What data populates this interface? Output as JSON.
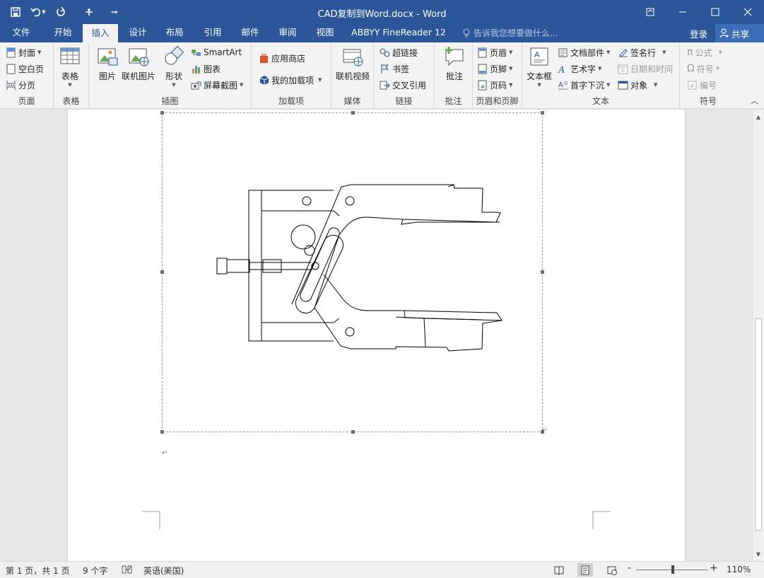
{
  "window": {
    "title": "CAD复制到Word.docx - Word"
  },
  "tabs": [
    {
      "label": "文件"
    },
    {
      "label": "开始"
    },
    {
      "label": "插入"
    },
    {
      "label": "设计"
    },
    {
      "label": "布局"
    },
    {
      "label": "引用"
    },
    {
      "label": "邮件"
    },
    {
      "label": "审阅"
    },
    {
      "label": "视图"
    },
    {
      "label": "ABBYY FineReader 12"
    }
  ],
  "active_tab": "插入",
  "tell_me": "告诉我您想要做什么...",
  "account": {
    "login": "登录",
    "share": "共享"
  },
  "ribbon": {
    "pages": {
      "label": "页面",
      "cover": "封面",
      "blank": "空白页",
      "break": "分页"
    },
    "tables": {
      "label": "表格",
      "table": "表格"
    },
    "illustrations": {
      "label": "插图",
      "picture": "图片",
      "online_picture": "联机图片",
      "shapes": "形状",
      "smartart": "SmartArt",
      "chart": "图表",
      "screenshot": "屏幕截图"
    },
    "addins": {
      "label": "加载项",
      "store": "应用商店",
      "my_addins": "我的加载项"
    },
    "media": {
      "label": "媒体",
      "online_video": "联机视频"
    },
    "links": {
      "label": "链接",
      "hyperlink": "超链接",
      "bookmark": "书签",
      "cross_ref": "交叉引用"
    },
    "comments": {
      "label": "批注",
      "comment": "批注"
    },
    "header_footer": {
      "label": "页眉和页脚",
      "header": "页眉",
      "footer": "页脚",
      "page_number": "页码"
    },
    "text": {
      "label": "文本",
      "textbox": "文本框",
      "quick_parts": "文档部件",
      "wordart": "艺术字",
      "drop_cap": "首字下沉",
      "signature": "签名行",
      "datetime": "日期和时间",
      "object": "对象"
    },
    "symbols": {
      "label": "符号",
      "equation": "公式",
      "symbol": "符号",
      "numbering": "编号"
    }
  },
  "status": {
    "page": "第 1 页，共 1 页",
    "words": "9 个字",
    "language": "英语(美国)",
    "zoom": "110%",
    "zoom_minus": "-",
    "zoom_plus": "+"
  }
}
